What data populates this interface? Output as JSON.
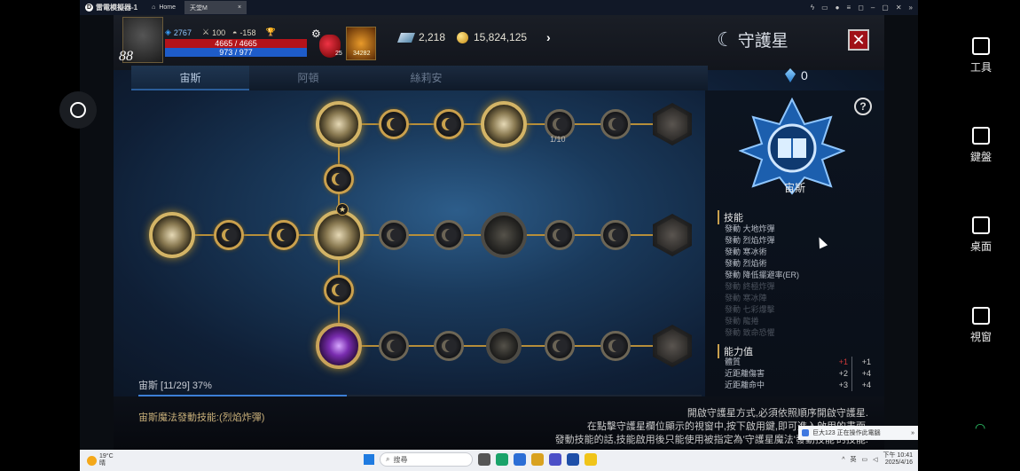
{
  "emulator": {
    "title": "雷電模擬器-1",
    "tabs": [
      {
        "label": "Home"
      },
      {
        "label": "天堂M"
      }
    ]
  },
  "hud": {
    "level": "88",
    "combat_power": "2767",
    "stat_attack": "100",
    "stat_defense": "-158",
    "hp": "4665 / 4665",
    "mp": "973 / 977",
    "potion_count": "25",
    "skill_slot_text": "34282",
    "diamonds": "2,218",
    "gold": "15,824,125"
  },
  "panel": {
    "title": "守護星",
    "crystal_count": "0",
    "tabs": [
      {
        "label": "宙斯",
        "active": true
      },
      {
        "label": "阿頓",
        "active": false
      },
      {
        "label": "絲莉安",
        "active": false
      }
    ],
    "node_counter": "1/10",
    "progress_text": "宙斯 [11/29] 37%",
    "progress_fraction": 0.37,
    "footer_left": "宙斯魔法發動技能:(烈焰炸彈)",
    "footer_right": [
      "開啟守護星方式,必須依照順序開啟守護星.",
      "在點擊守護星欄位顯示的視窗中,按下啟用鍵,即可進入啟用的畫面.",
      "發動技能的話,技能啟用後只能使用被指定為'守護星魔法'發動技能'的技能."
    ]
  },
  "detail": {
    "name": "宙斯",
    "skills_title": "技能",
    "skills": [
      {
        "label": "發動 大地炸彈",
        "active": true
      },
      {
        "label": "發動 烈焰炸彈",
        "active": true
      },
      {
        "label": "發動 寒冰術",
        "active": true
      },
      {
        "label": "發動 烈焰術",
        "active": true
      },
      {
        "label": "發動 降低擺避率(ER)",
        "active": true
      },
      {
        "label": "發動 終極炸彈",
        "active": false
      },
      {
        "label": "發動 寒冰陣",
        "active": false
      },
      {
        "label": "發動 七彩爆擊",
        "active": false
      },
      {
        "label": "發動 龍捲",
        "active": false
      },
      {
        "label": "發動 致命恐懼",
        "active": false
      }
    ],
    "abilities_title": "能力值",
    "abilities": [
      {
        "label": "體質",
        "delta": "+1",
        "total": "+1"
      },
      {
        "label": "近距離傷害",
        "delta": "+2",
        "total": "+4"
      },
      {
        "label": "近距離命中",
        "delta": "+3",
        "total": "+4"
      }
    ]
  },
  "sidebar": {
    "items": [
      {
        "label": "工具"
      },
      {
        "label": "鍵盤"
      },
      {
        "label": "桌面"
      },
      {
        "label": "視窗"
      }
    ]
  },
  "notification": {
    "text": "巨大123 正在操作此電腦"
  },
  "taskbar": {
    "weather_temp": "19°C",
    "weather_desc": "晴",
    "search_placeholder": "搜尋",
    "lang": "英",
    "time": "下午 10:41",
    "date": "2025/4/16"
  },
  "colors": {
    "gold_line": "#b68e3a",
    "hp": "#b3131a",
    "mp": "#1e5cc9",
    "progress": "#3c7fd6"
  }
}
